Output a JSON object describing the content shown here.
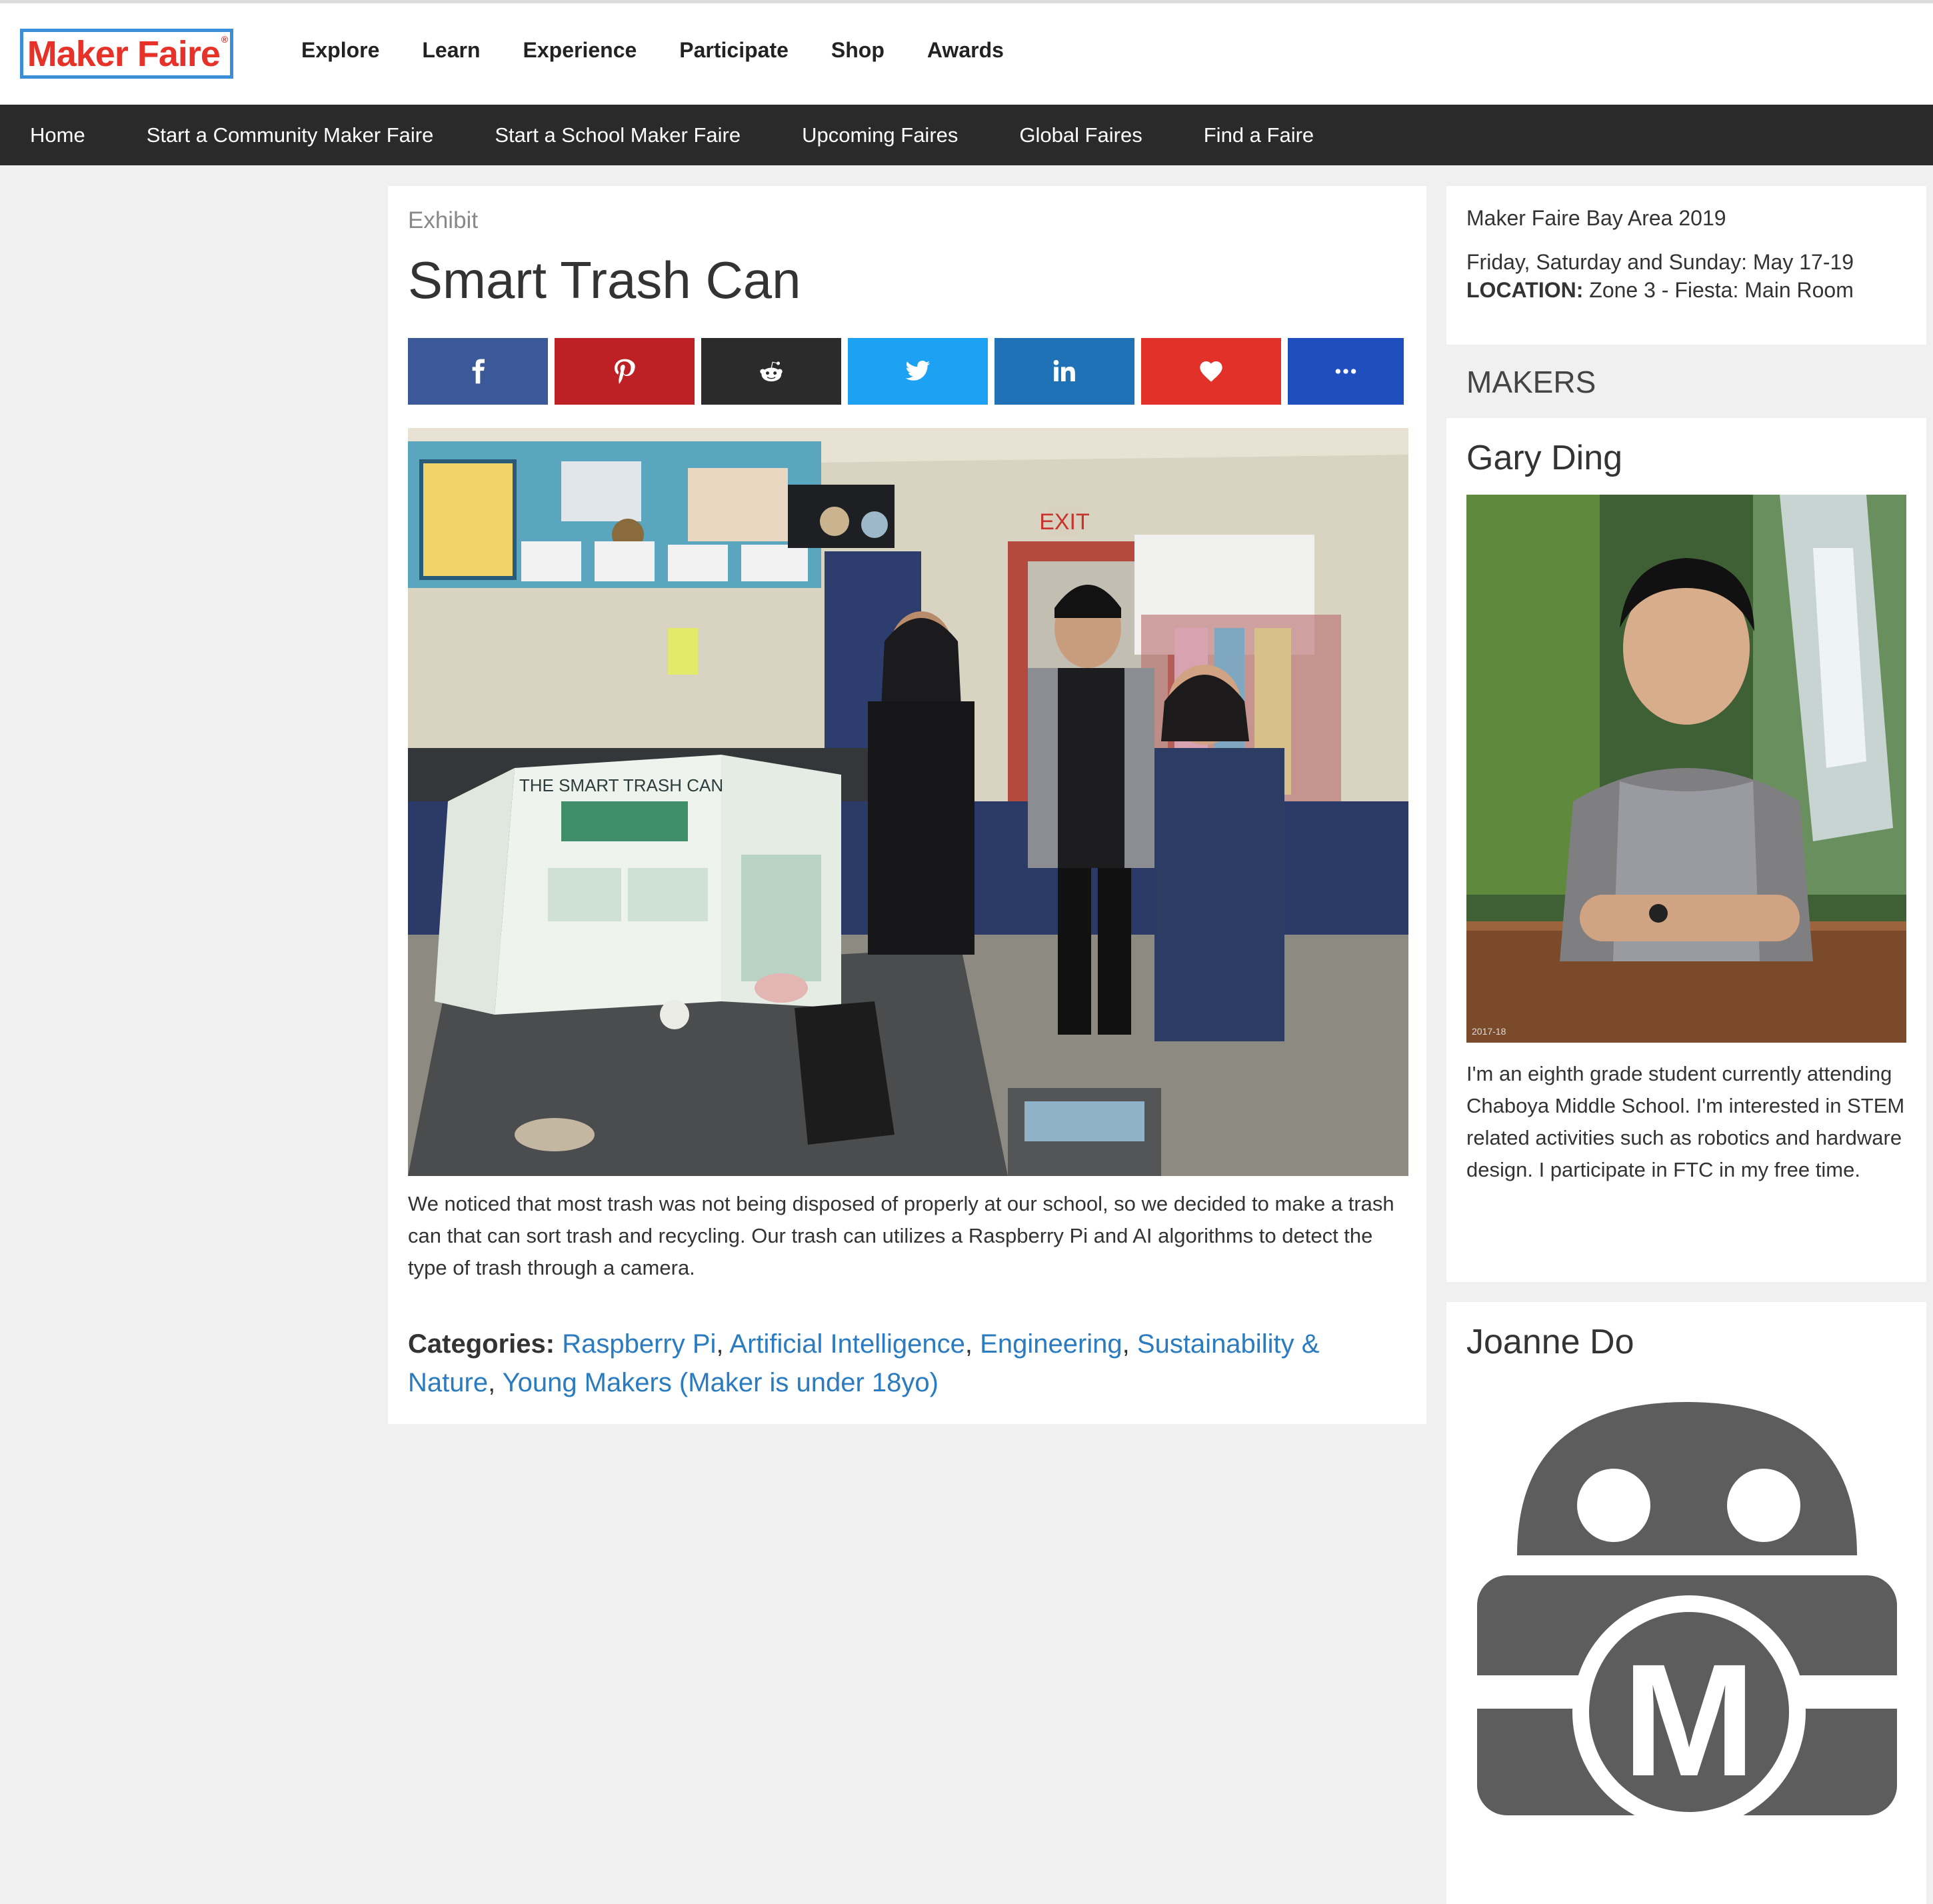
{
  "header": {
    "logo_text": "Maker Faire",
    "logo_reg": "®",
    "nav": [
      "Explore",
      "Learn",
      "Experience",
      "Participate",
      "Shop",
      "Awards"
    ]
  },
  "subnav": [
    "Home",
    "Start a Community Maker Faire",
    "Start a School Maker Faire",
    "Upcoming Faires",
    "Global Faires",
    "Find a Faire"
  ],
  "exhibit": {
    "type": "Exhibit",
    "title": "Smart Trash Can",
    "share_icons": [
      "facebook-icon",
      "pinterest-icon",
      "reddit-icon",
      "twitter-icon",
      "linkedin-icon",
      "heart-icon",
      "more-icon"
    ],
    "photo_board_text": "THE SMART TRASH CAN",
    "photo_exit_sign": "EXIT",
    "description": "We noticed that most trash was not being disposed of properly at our school, so we decided to make a trash can that can sort trash and recycling. Our trash can utilizes a Raspberry Pi and AI algorithms to detect the type of trash through a camera.",
    "categories_label": "Categories:",
    "categories": [
      "Raspberry Pi",
      "Artificial Intelligence",
      "Engineering",
      "Sustainability & Nature",
      "Young Makers (Maker is under 18yo)"
    ]
  },
  "event": {
    "name": "Maker Faire Bay Area 2019",
    "dates": "Friday, Saturday and Sunday: May 17-19",
    "location_label": "LOCATION:",
    "location": "Zone 3 - Fiesta: Main Room"
  },
  "makers_heading": "MAKERS",
  "makers": [
    {
      "name": "Gary Ding",
      "photo_caption": "2017-18",
      "bio": "I'm an eighth grade student currently attending Chaboya Middle School. I'm interested in STEM related activities such as robotics and hardware design. I participate in FTC in my free time."
    },
    {
      "name": "Joanne Do",
      "logo_letter": "M"
    }
  ],
  "colors": {
    "brand_red": "#e63229",
    "logo_border": "#3b8fd9",
    "subnav_bg": "#2a2a2a",
    "link_blue": "#2a7bbf",
    "facebook": "#3b5998",
    "pinterest": "#bd2126",
    "reddit": "#2b2b2b",
    "twitter": "#1da1f2",
    "linkedin": "#1f72b5",
    "heart": "#e13128",
    "more": "#1f4fbf"
  }
}
